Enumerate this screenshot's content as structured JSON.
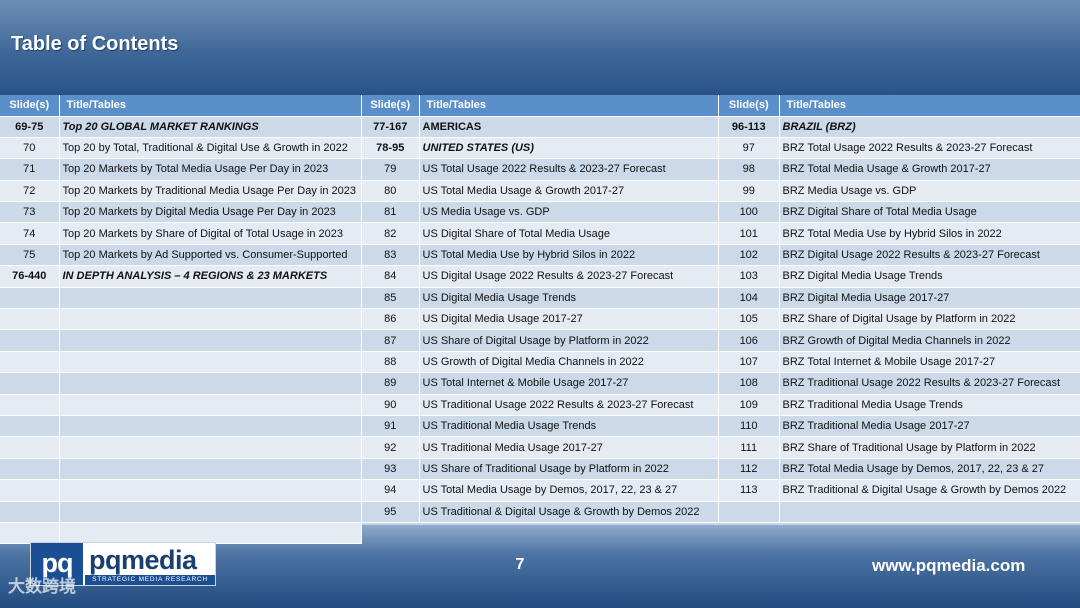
{
  "header": {
    "title": "Table of Contents"
  },
  "columns": {
    "slide_header": "Slide(s)",
    "title_header": "Title/Tables"
  },
  "tables": [
    {
      "rows": [
        {
          "slide": "69-75",
          "title": "Top 20 GLOBAL MARKET RANKINGS",
          "kind": "section"
        },
        {
          "slide": "70",
          "title": "Top 20 by Total, Traditional & Digital Use & Growth in 2022",
          "kind": "item"
        },
        {
          "slide": "71",
          "title": "Top 20 Markets by Total Media Usage Per Day in 2023",
          "kind": "item"
        },
        {
          "slide": "72",
          "title": "Top 20 Markets by Traditional Media Usage Per Day in 2023",
          "kind": "item"
        },
        {
          "slide": "73",
          "title": "Top 20 Markets by Digital Media Usage Per Day in 2023",
          "kind": "item"
        },
        {
          "slide": "74",
          "title": "Top 20 Markets by Share of Digital of Total Usage in 2023",
          "kind": "item"
        },
        {
          "slide": "75",
          "title": "Top 20 Markets by Ad Supported vs. Consumer-Supported",
          "kind": "item"
        },
        {
          "slide": "76-440",
          "title": "IN DEPTH ANALYSIS – 4 REGIONS & 23 MARKETS",
          "kind": "section"
        },
        {
          "slide": "",
          "title": "",
          "kind": "empty"
        },
        {
          "slide": "",
          "title": "",
          "kind": "empty"
        },
        {
          "slide": "",
          "title": "",
          "kind": "empty"
        },
        {
          "slide": "",
          "title": "",
          "kind": "empty"
        },
        {
          "slide": "",
          "title": "",
          "kind": "empty"
        },
        {
          "slide": "",
          "title": "",
          "kind": "empty"
        },
        {
          "slide": "",
          "title": "",
          "kind": "empty"
        },
        {
          "slide": "",
          "title": "",
          "kind": "empty"
        },
        {
          "slide": "",
          "title": "",
          "kind": "empty"
        },
        {
          "slide": "",
          "title": "",
          "kind": "empty"
        },
        {
          "slide": "",
          "title": "",
          "kind": "empty"
        },
        {
          "slide": "",
          "title": "",
          "kind": "empty"
        }
      ]
    },
    {
      "rows": [
        {
          "slide": "77-167",
          "title": "AMERICAS",
          "kind": "plainbold"
        },
        {
          "slide": "78-95",
          "title": "UNITED STATES (US)",
          "kind": "section"
        },
        {
          "slide": "79",
          "title": "US Total Usage 2022 Results & 2023-27 Forecast",
          "kind": "item"
        },
        {
          "slide": "80",
          "title": "US Total Media Usage & Growth 2017-27",
          "kind": "item"
        },
        {
          "slide": "81",
          "title": "US Media Usage vs. GDP",
          "kind": "item"
        },
        {
          "slide": "82",
          "title": "US Digital Share of Total Media Usage",
          "kind": "item"
        },
        {
          "slide": "83",
          "title": "US Total Media Use by Hybrid Silos in 2022",
          "kind": "item"
        },
        {
          "slide": "84",
          "title": "US Digital Usage 2022 Results & 2023-27 Forecast",
          "kind": "item"
        },
        {
          "slide": "85",
          "title": "US Digital Media Usage Trends",
          "kind": "item"
        },
        {
          "slide": "86",
          "title": "US Digital Media Usage 2017-27",
          "kind": "item"
        },
        {
          "slide": "87",
          "title": "US Share of Digital Usage by Platform in 2022",
          "kind": "item"
        },
        {
          "slide": "88",
          "title": "US Growth of Digital Media Channels in 2022",
          "kind": "item"
        },
        {
          "slide": "89",
          "title": "US Total Internet & Mobile Usage 2017-27",
          "kind": "item"
        },
        {
          "slide": "90",
          "title": "US Traditional Usage 2022 Results & 2023-27 Forecast",
          "kind": "item"
        },
        {
          "slide": "91",
          "title": "US Traditional Media Usage Trends",
          "kind": "item"
        },
        {
          "slide": "92",
          "title": "US Traditional Media Usage 2017-27",
          "kind": "item"
        },
        {
          "slide": "93",
          "title": "US Share of Traditional Usage by Platform in 2022",
          "kind": "item"
        },
        {
          "slide": "94",
          "title": "US Total Media Usage by Demos, 2017, 22, 23 & 27",
          "kind": "item"
        },
        {
          "slide": "95",
          "title": "US Traditional & Digital Usage & Growth by Demos 2022",
          "kind": "item"
        }
      ]
    },
    {
      "rows": [
        {
          "slide": "96-113",
          "title": "BRAZIL (BRZ)",
          "kind": "section"
        },
        {
          "slide": "97",
          "title": "BRZ Total Usage 2022 Results & 2023-27 Forecast",
          "kind": "item"
        },
        {
          "slide": "98",
          "title": "BRZ Total Media Usage & Growth 2017-27",
          "kind": "item"
        },
        {
          "slide": "99",
          "title": "BRZ Media Usage vs. GDP",
          "kind": "item"
        },
        {
          "slide": "100",
          "title": "BRZ Digital Share of Total Media Usage",
          "kind": "item"
        },
        {
          "slide": "101",
          "title": "BRZ Total Media Use by Hybrid Silos in 2022",
          "kind": "item"
        },
        {
          "slide": "102",
          "title": "BRZ Digital Usage 2022 Results & 2023-27 Forecast",
          "kind": "item"
        },
        {
          "slide": "103",
          "title": "BRZ Digital Media Usage Trends",
          "kind": "item"
        },
        {
          "slide": "104",
          "title": "BRZ Digital Media Usage 2017-27",
          "kind": "item"
        },
        {
          "slide": "105",
          "title": "BRZ Share of Digital Usage by Platform in 2022",
          "kind": "item"
        },
        {
          "slide": "106",
          "title": "BRZ Growth of Digital Media Channels in 2022",
          "kind": "item"
        },
        {
          "slide": "107",
          "title": "BRZ Total Internet & Mobile Usage 2017-27",
          "kind": "item"
        },
        {
          "slide": "108",
          "title": "BRZ Traditional Usage 2022 Results & 2023-27 Forecast",
          "kind": "item"
        },
        {
          "slide": "109",
          "title": "BRZ Traditional Media Usage Trends",
          "kind": "item"
        },
        {
          "slide": "110",
          "title": "BRZ Traditional Media Usage 2017-27",
          "kind": "item"
        },
        {
          "slide": "111",
          "title": "BRZ Share of Traditional Usage by Platform in 2022",
          "kind": "item"
        },
        {
          "slide": "112",
          "title": "BRZ Total Media Usage by Demos, 2017, 22, 23 & 27",
          "kind": "item"
        },
        {
          "slide": "113",
          "title": "BRZ Traditional & Digital Usage & Growth by Demos 2022",
          "kind": "item"
        },
        {
          "slide": "",
          "title": "",
          "kind": "empty"
        }
      ]
    }
  ],
  "footer": {
    "logo_mark": "pq",
    "logo_word": "pqmedia",
    "logo_tagline": "STRATEGIC MEDIA RESEARCH",
    "page_number": "7",
    "url": "www.pqmedia.com",
    "watermark": "大数跨境"
  },
  "colors": {
    "header_band": "#3f6898",
    "table_header": "#5b8fc9",
    "row_alt": "#cbd9e8",
    "row_base": "#e4ebf3",
    "logo_blue": "#1b4f93"
  }
}
